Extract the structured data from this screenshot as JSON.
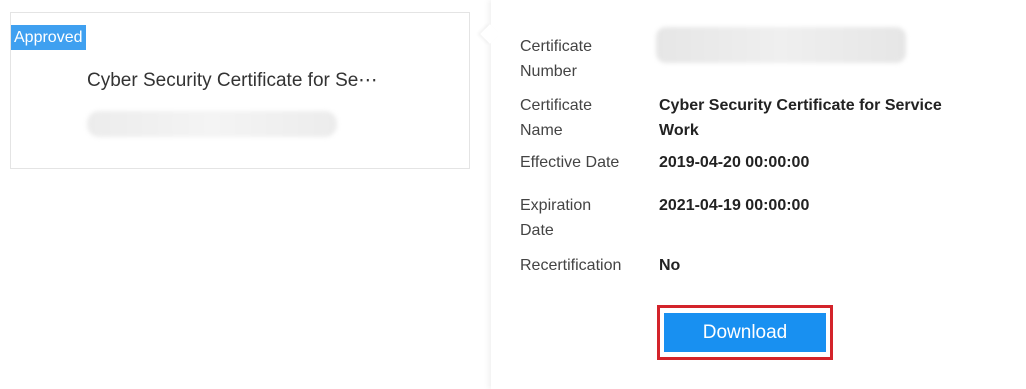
{
  "card": {
    "status": "Approved",
    "title": "Cyber Security Certificate for Se⋯"
  },
  "details": {
    "certificate_number_label": "Certificate\nNumber",
    "certificate_name_label": "Certificate\nName",
    "certificate_name_value": "Cyber Security Certificate for Service\nWork",
    "effective_date_label": "Effective Date",
    "effective_date_value": "2019-04-20 00:00:00",
    "expiration_date_label": "Expiration\nDate",
    "expiration_date_value": "2021-04-19 00:00:00",
    "recertification_label": "Recertification",
    "recertification_value": "No"
  },
  "actions": {
    "download_label": "Download"
  },
  "colors": {
    "badge": "#3fa0f0",
    "button": "#1890f1",
    "highlight": "#d3232a"
  }
}
